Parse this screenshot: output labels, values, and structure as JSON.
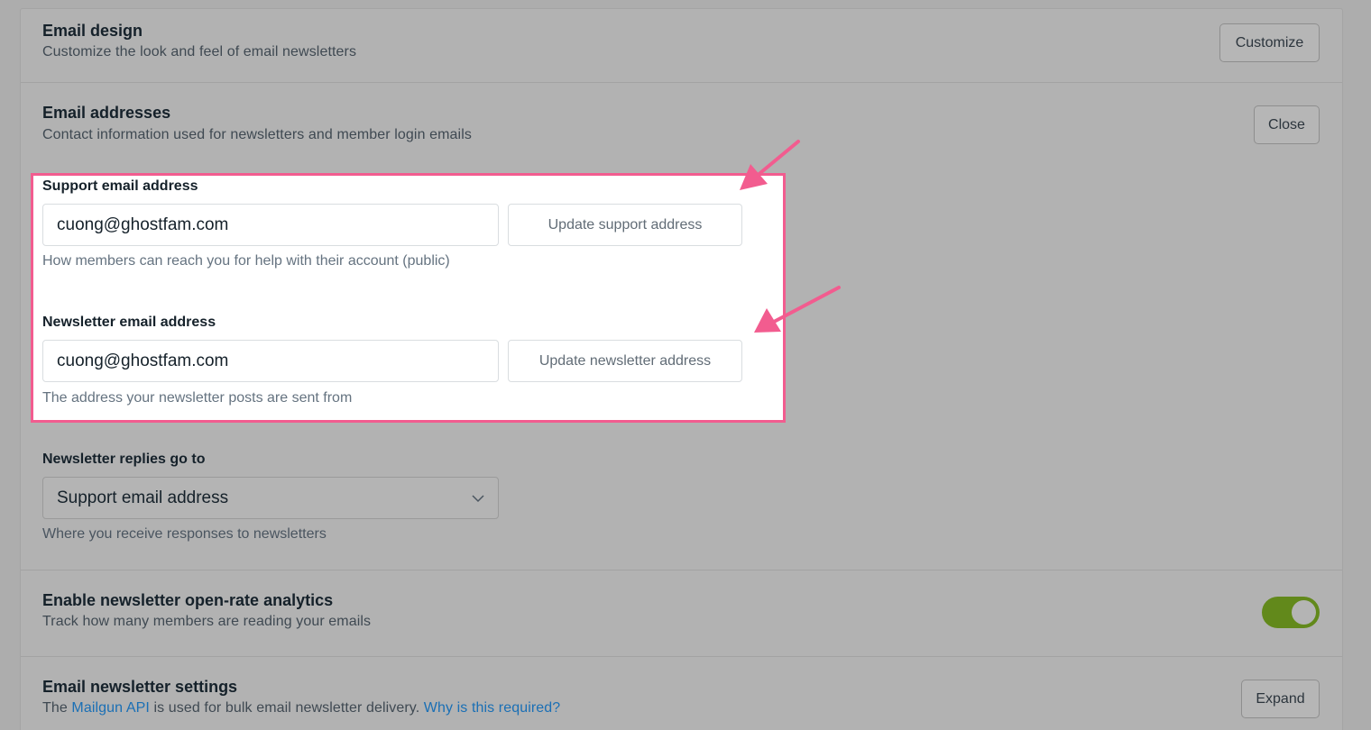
{
  "email_design": {
    "title": "Email design",
    "description": "Customize the look and feel of email newsletters",
    "button": "Customize"
  },
  "email_addresses": {
    "title": "Email addresses",
    "description": "Contact information used for newsletters and member login emails",
    "button": "Close",
    "support": {
      "label": "Support email address",
      "value": "cuong@ghostfam.com",
      "button": "Update support address",
      "hint": "How members can reach you for help with their account (public)"
    },
    "newsletter": {
      "label": "Newsletter email address",
      "value": "cuong@ghostfam.com",
      "button": "Update newsletter address",
      "hint": "The address your newsletter posts are sent from"
    },
    "replies": {
      "label": "Newsletter replies go to",
      "selected": "Support email address",
      "hint": "Where you receive responses to newsletters"
    }
  },
  "open_rate": {
    "title": "Enable newsletter open-rate analytics",
    "description": "Track how many members are reading your emails",
    "enabled": true
  },
  "newsletter_settings": {
    "title": "Email newsletter settings",
    "description_before": "The",
    "link_mailgun": "Mailgun API",
    "description_middle": "is used for bulk email newsletter delivery.",
    "link_why": "Why is this required?",
    "button": "Expand"
  },
  "colors": {
    "highlight": "#f25c8f",
    "toggle_on": "#62891b",
    "link": "#1a6fb5"
  }
}
